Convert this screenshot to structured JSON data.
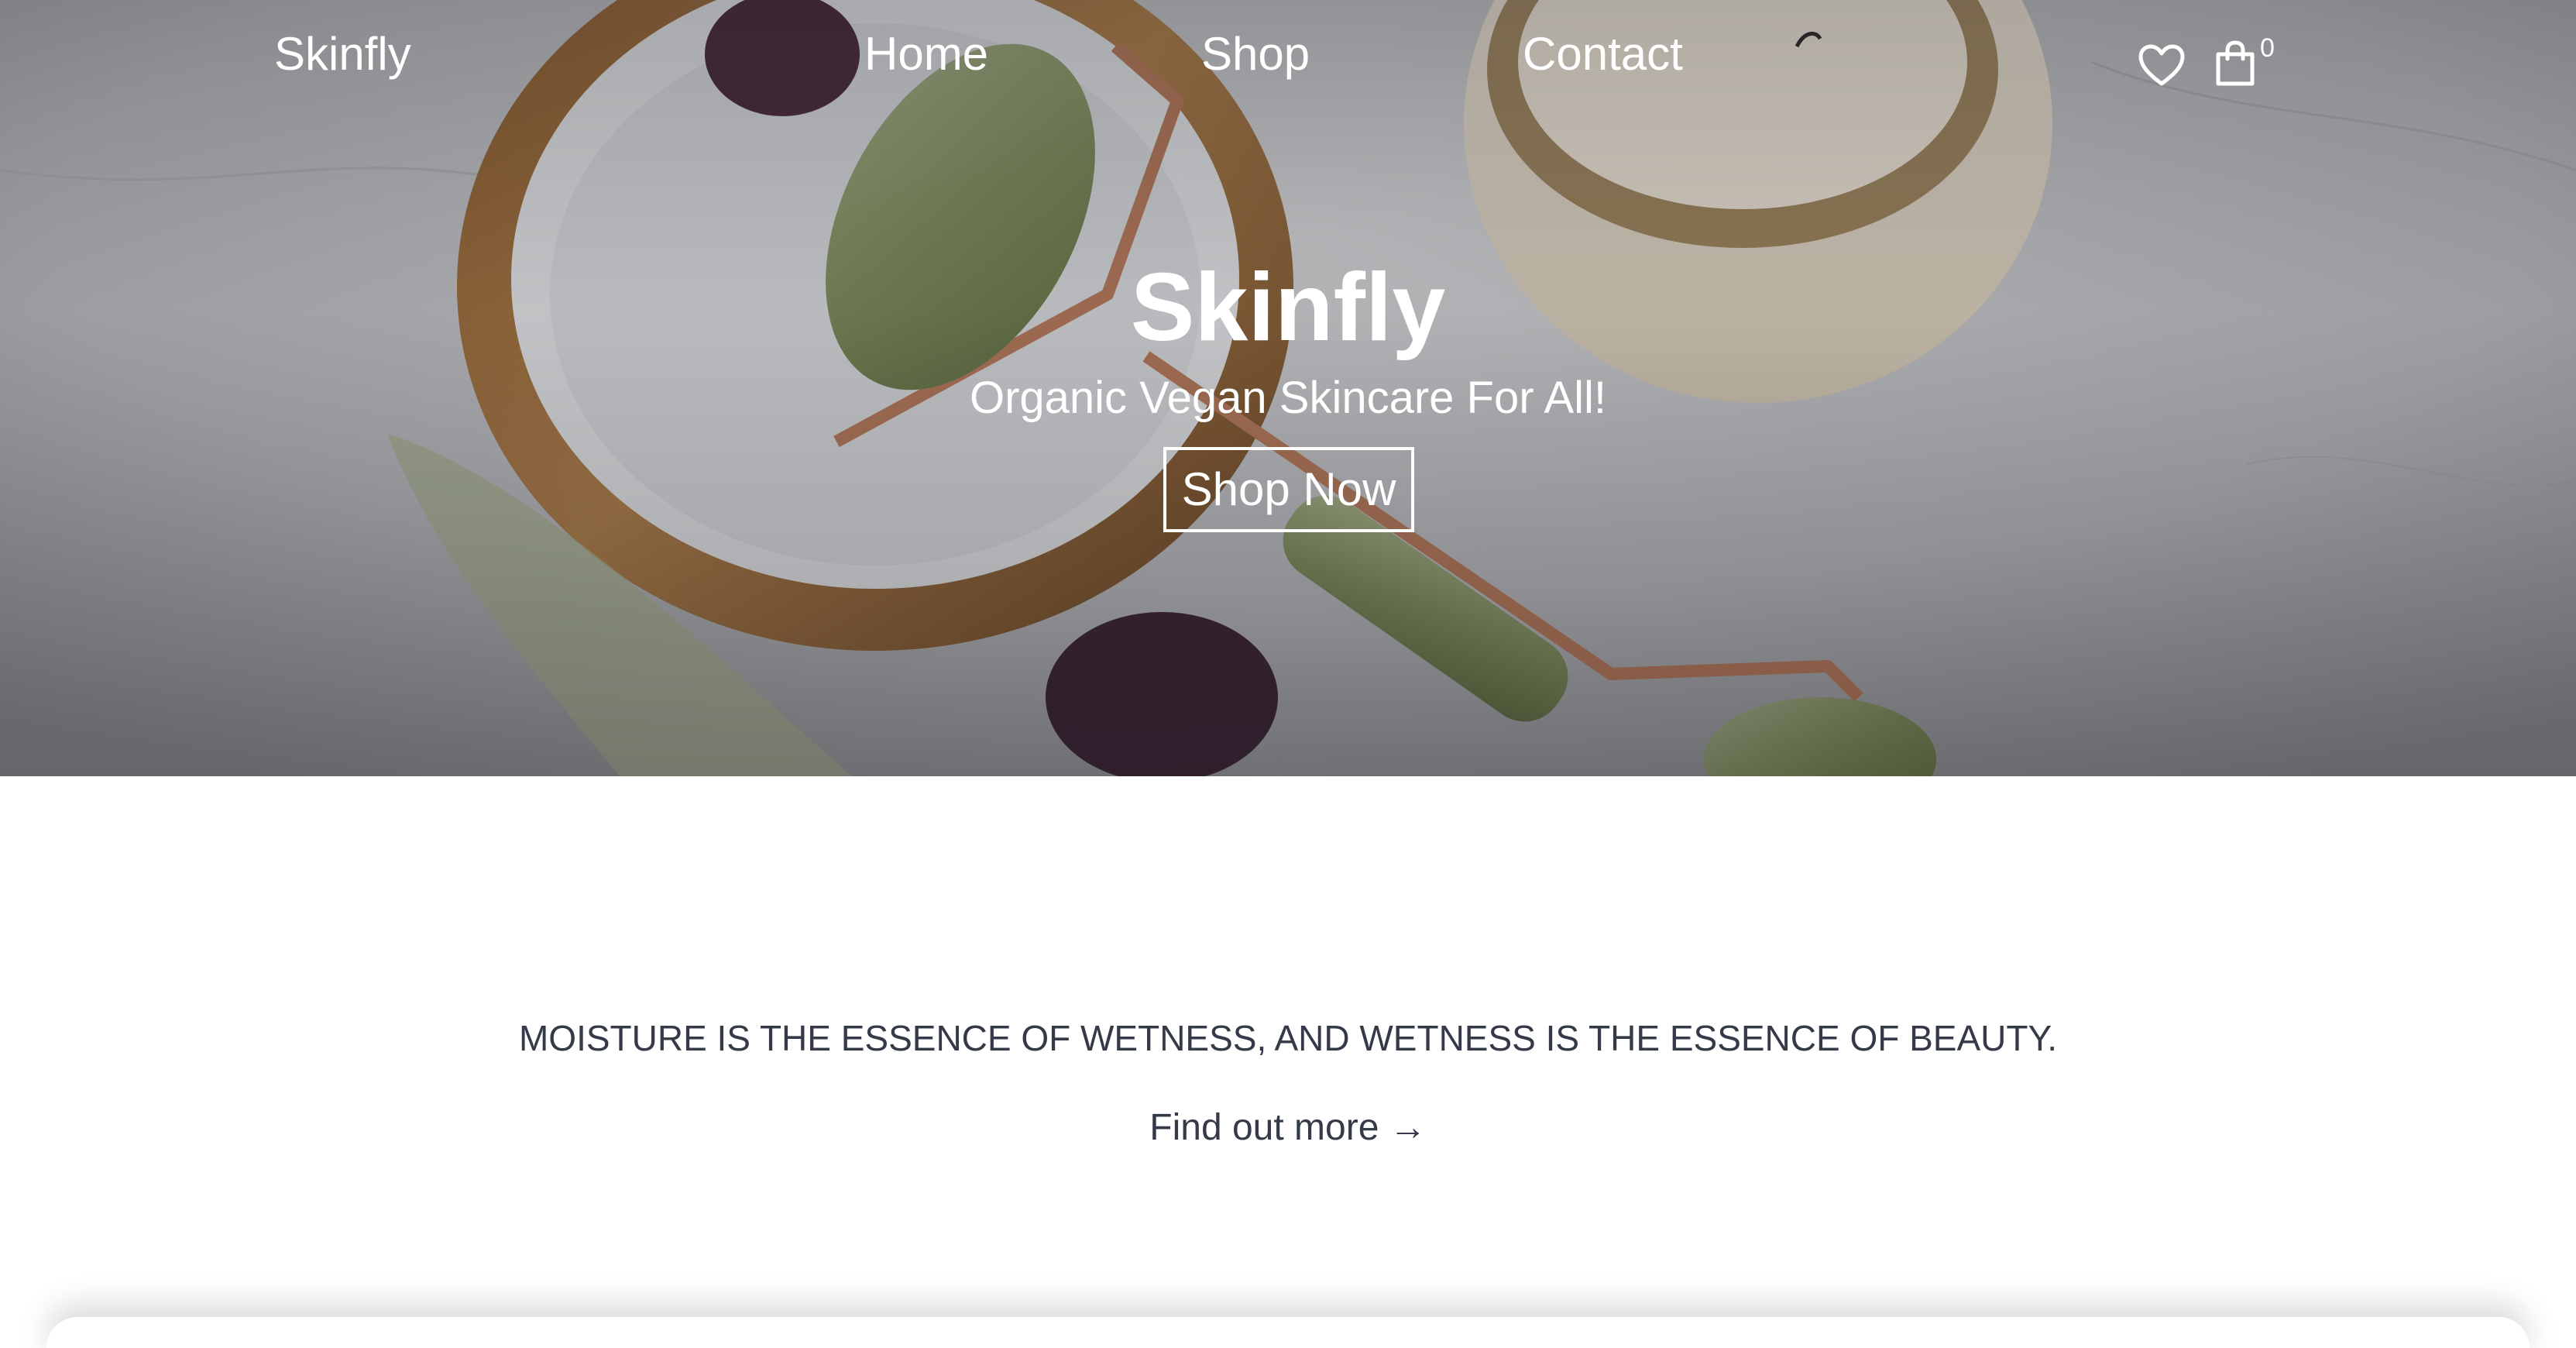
{
  "nav": {
    "brand": "Skinfly",
    "links": [
      {
        "label": "Home"
      },
      {
        "label": "Shop"
      },
      {
        "label": "Contact"
      }
    ],
    "icons": {
      "wishlist": "heart-icon",
      "cart": "shopping-bag-icon"
    },
    "cart_count": "0"
  },
  "hero": {
    "title": "Skinfly",
    "subtitle": "Organic Vegan Skincare For All!",
    "cta_label": "Shop Now"
  },
  "intro": {
    "quote": "MOISTURE IS THE ESSENCE OF WETNESS, AND WETNESS IS THE ESSENCE OF BEAUTY.",
    "link_label": "Find out more →"
  },
  "colors": {
    "text_dark": "#343a48",
    "hero_text": "#ffffff"
  }
}
